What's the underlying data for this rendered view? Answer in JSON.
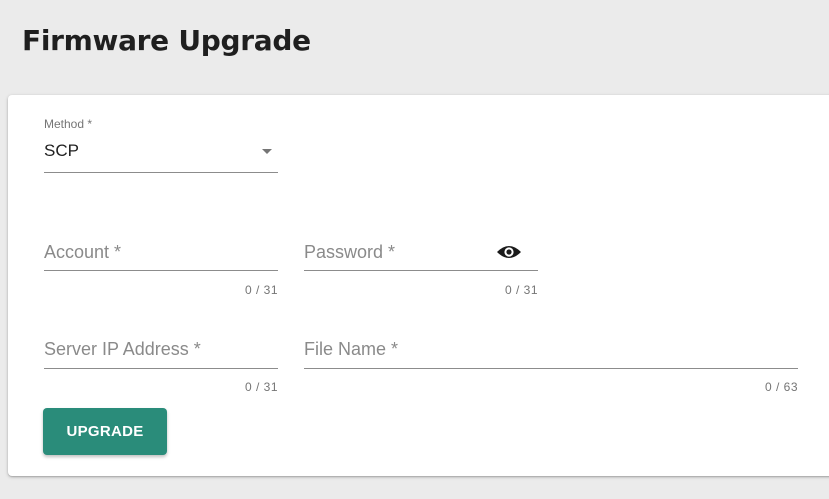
{
  "page": {
    "title": "Firmware Upgrade"
  },
  "form": {
    "method": {
      "label": "Method *",
      "value": "SCP"
    },
    "account": {
      "placeholder": "Account *",
      "counter": "0 / 31"
    },
    "password": {
      "placeholder": "Password *",
      "counter": "0 / 31",
      "toggle_icon": "eye-icon"
    },
    "server_ip": {
      "placeholder": "Server IP Address *",
      "counter": "0 / 31"
    },
    "file_name": {
      "placeholder": "File Name *",
      "counter": "0 / 63"
    },
    "upgrade_label": "UPGRADE"
  },
  "colors": {
    "page_background": "#ebebeb",
    "card_background": "#ffffff",
    "primary_button": "#2a8c7a",
    "text_primary": "#212121",
    "text_secondary": "#757575"
  }
}
